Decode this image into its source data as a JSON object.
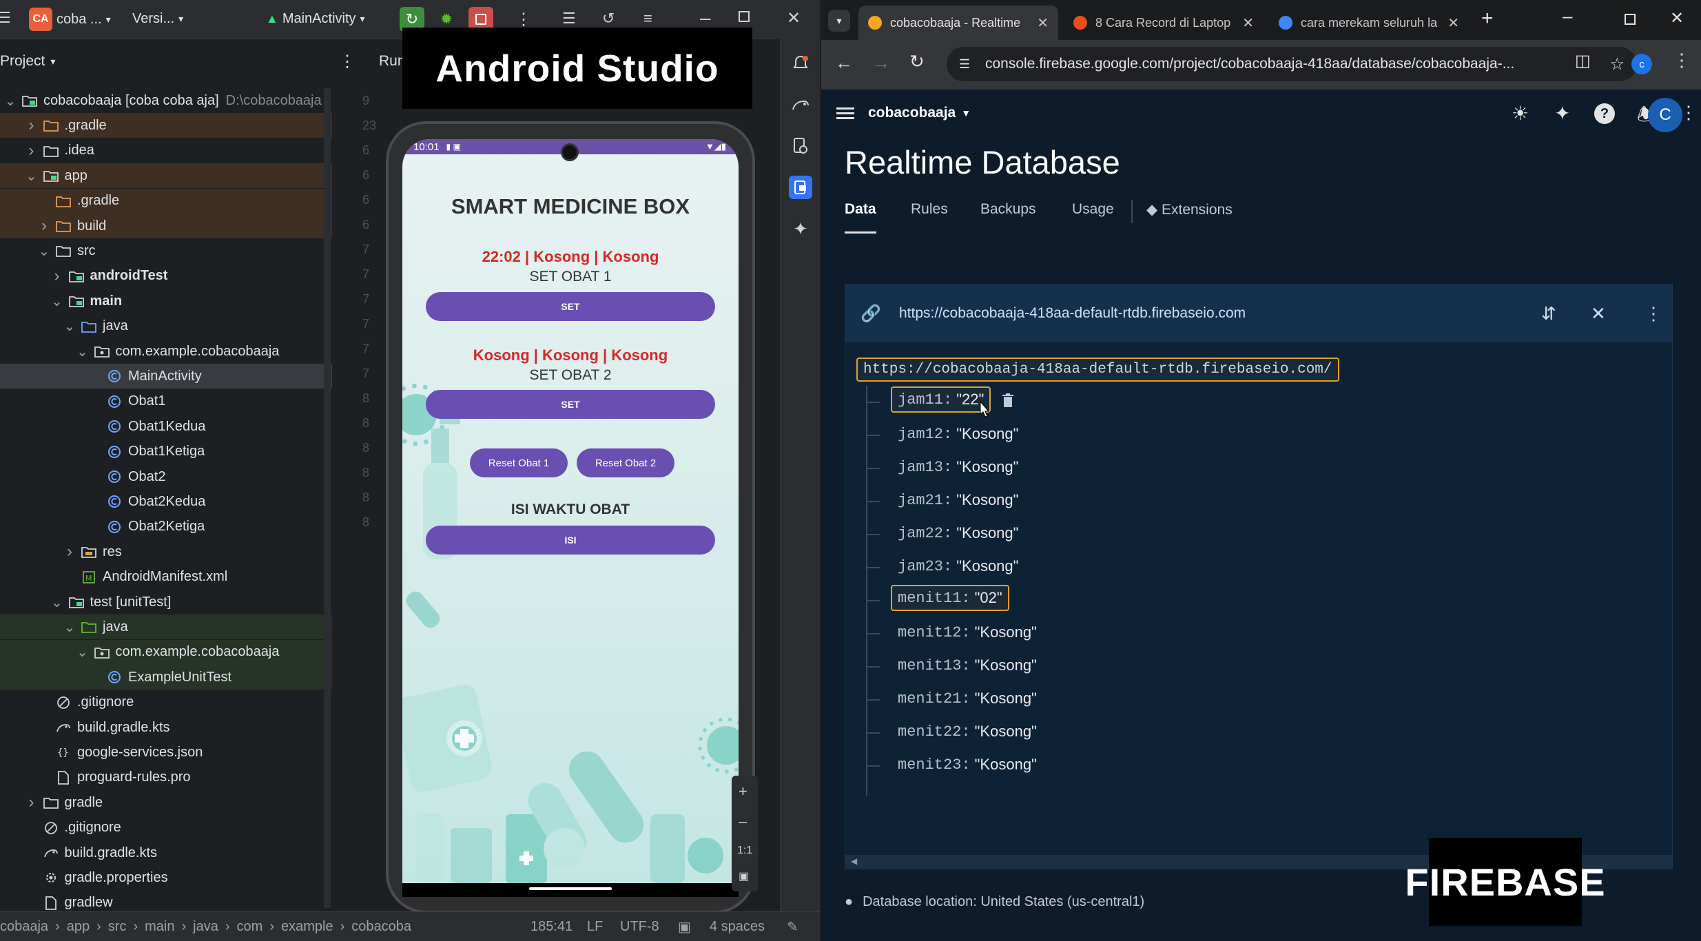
{
  "android_studio": {
    "titlebar": {
      "project_badge": "CA",
      "project_name": "coba ...",
      "vcs": "Versi...",
      "run_config": "MainActivity"
    },
    "project_header": "Project",
    "run_tab": "Run",
    "tree": [
      {
        "label": "cobacobaaja [coba coba aja]",
        "suffix": "D:\\cobacobaaja",
        "indent": 0,
        "chev": "down",
        "icon": "module"
      },
      {
        "label": ".gradle",
        "indent": 1,
        "chev": "right",
        "icon": "folder-orange",
        "bg": "orange"
      },
      {
        "label": ".idea",
        "indent": 1,
        "chev": "right",
        "icon": "folder"
      },
      {
        "label": "app",
        "indent": 1,
        "chev": "down",
        "icon": "module",
        "bg": "orange"
      },
      {
        "label": ".gradle",
        "indent": 2,
        "chev": "",
        "icon": "folder-orange",
        "bg": "orange"
      },
      {
        "label": "build",
        "indent": 2,
        "chev": "right",
        "icon": "folder-orange",
        "bg": "orange"
      },
      {
        "label": "src",
        "indent": 2,
        "chev": "down",
        "icon": "folder"
      },
      {
        "label": "androidTest",
        "indent": 3,
        "chev": "right",
        "icon": "module",
        "bold": true
      },
      {
        "label": "main",
        "indent": 3,
        "chev": "down",
        "icon": "module",
        "bold": true
      },
      {
        "label": "java",
        "indent": 4,
        "chev": "down",
        "icon": "folder-blue"
      },
      {
        "label": "com.example.cobacobaaja",
        "indent": 5,
        "chev": "down",
        "icon": "package"
      },
      {
        "label": "MainActivity",
        "indent": 6,
        "chev": "",
        "icon": "class",
        "selected": true
      },
      {
        "label": "Obat1",
        "indent": 6,
        "chev": "",
        "icon": "class"
      },
      {
        "label": "Obat1Kedua",
        "indent": 6,
        "chev": "",
        "icon": "class"
      },
      {
        "label": "Obat1Ketiga",
        "indent": 6,
        "chev": "",
        "icon": "class"
      },
      {
        "label": "Obat2",
        "indent": 6,
        "chev": "",
        "icon": "class"
      },
      {
        "label": "Obat2Kedua",
        "indent": 6,
        "chev": "",
        "icon": "class"
      },
      {
        "label": "Obat2Ketiga",
        "indent": 6,
        "chev": "",
        "icon": "class"
      },
      {
        "label": "res",
        "indent": 4,
        "chev": "right",
        "icon": "folder-res"
      },
      {
        "label": "AndroidManifest.xml",
        "indent": 4,
        "chev": "",
        "icon": "manifest"
      },
      {
        "label": "test [unitTest]",
        "indent": 3,
        "chev": "down",
        "icon": "module"
      },
      {
        "label": "java",
        "indent": 4,
        "chev": "down",
        "icon": "folder-green",
        "bg": "green"
      },
      {
        "label": "com.example.cobacobaaja",
        "indent": 5,
        "chev": "down",
        "icon": "package",
        "bg": "green"
      },
      {
        "label": "ExampleUnitTest",
        "indent": 6,
        "chev": "",
        "icon": "class",
        "bg": "green"
      },
      {
        "label": ".gitignore",
        "indent": 2,
        "chev": "",
        "icon": "ignore"
      },
      {
        "label": "build.gradle.kts",
        "indent": 2,
        "chev": "",
        "icon": "gradle"
      },
      {
        "label": "google-services.json",
        "indent": 2,
        "chev": "",
        "icon": "json"
      },
      {
        "label": "proguard-rules.pro",
        "indent": 2,
        "chev": "",
        "icon": "file"
      },
      {
        "label": "gradle",
        "indent": 1,
        "chev": "right",
        "icon": "folder"
      },
      {
        "label": ".gitignore",
        "indent": 1,
        "chev": "",
        "icon": "ignore"
      },
      {
        "label": "build.gradle.kts",
        "indent": 1,
        "chev": "",
        "icon": "gradle"
      },
      {
        "label": "gradle.properties",
        "indent": 1,
        "chev": "",
        "icon": "gear"
      },
      {
        "label": "gradlew",
        "indent": 1,
        "chev": "",
        "icon": "file"
      }
    ],
    "gutter_lines": [
      "9",
      "23",
      "6",
      "6",
      "6",
      "6",
      "7",
      "7",
      "7",
      "7",
      "7",
      "7",
      "8",
      "8",
      "8",
      "8",
      "8",
      "8"
    ],
    "statusbar": {
      "crumbs": [
        "cobaaja",
        "app",
        "src",
        "main",
        "java",
        "com",
        "example",
        "cobacoba"
      ],
      "position": "185:41",
      "line_ending": "LF",
      "encoding": "UTF-8",
      "indent": "4 spaces"
    },
    "overlay_label": "Android Studio"
  },
  "phone": {
    "time": "10:01",
    "app_title": "SMART MEDICINE BOX",
    "obat1_status": "22:02  |  Kosong  |  Kosong",
    "obat1_label": "SET OBAT 1",
    "obat1_button": "SET",
    "obat2_status": "Kosong  |  Kosong  |  Kosong",
    "obat2_label": "SET OBAT 2",
    "obat2_button": "SET",
    "reset1": "Reset Obat 1",
    "reset2": "Reset Obat 2",
    "isi_title": "ISI WAKTU OBAT",
    "isi_button": "ISI",
    "zoom_label": "1:1"
  },
  "chrome": {
    "tabs": [
      {
        "title": "cobacobaaja - Realtime",
        "favicon": "#f5a623",
        "active": true
      },
      {
        "title": "8 Cara Record di Laptop",
        "favicon": "#e8501a",
        "active": false
      },
      {
        "title": "cara merekam seluruh la",
        "favicon": "#4285f4",
        "active": false
      }
    ],
    "url": "console.firebase.google.com/project/cobacobaaja-418aa/database/cobacobaaja-...",
    "profile_initial": "c"
  },
  "firebase": {
    "project": "cobacobaaja",
    "page_title": "Realtime Database",
    "tabs": [
      "Data",
      "Rules",
      "Backups",
      "Usage",
      "Extensions"
    ],
    "db_url": "https://cobacobaaja-418aa-default-rtdb.firebaseio.com",
    "root_url": "https://cobacobaaja-418aa-default-rtdb.firebaseio.com/",
    "entries": [
      {
        "key": "jam11",
        "value": "\"22\"",
        "highlight": true
      },
      {
        "key": "jam12",
        "value": "\"Kosong\""
      },
      {
        "key": "jam13",
        "value": "\"Kosong\""
      },
      {
        "key": "jam21",
        "value": "\"Kosong\""
      },
      {
        "key": "jam22",
        "value": "\"Kosong\""
      },
      {
        "key": "jam23",
        "value": "\"Kosong\""
      },
      {
        "key": "menit11",
        "value": "\"02\"",
        "highlight": true
      },
      {
        "key": "menit12",
        "value": "\"Kosong\""
      },
      {
        "key": "menit13",
        "value": "\"Kosong\""
      },
      {
        "key": "menit21",
        "value": "\"Kosong\""
      },
      {
        "key": "menit22",
        "value": "\"Kosong\""
      },
      {
        "key": "menit23",
        "value": "\"Kosong\""
      }
    ],
    "location": "Database location: United States (us-central1)",
    "avatar_initial": "C",
    "overlay_label": "FIREBASE"
  }
}
